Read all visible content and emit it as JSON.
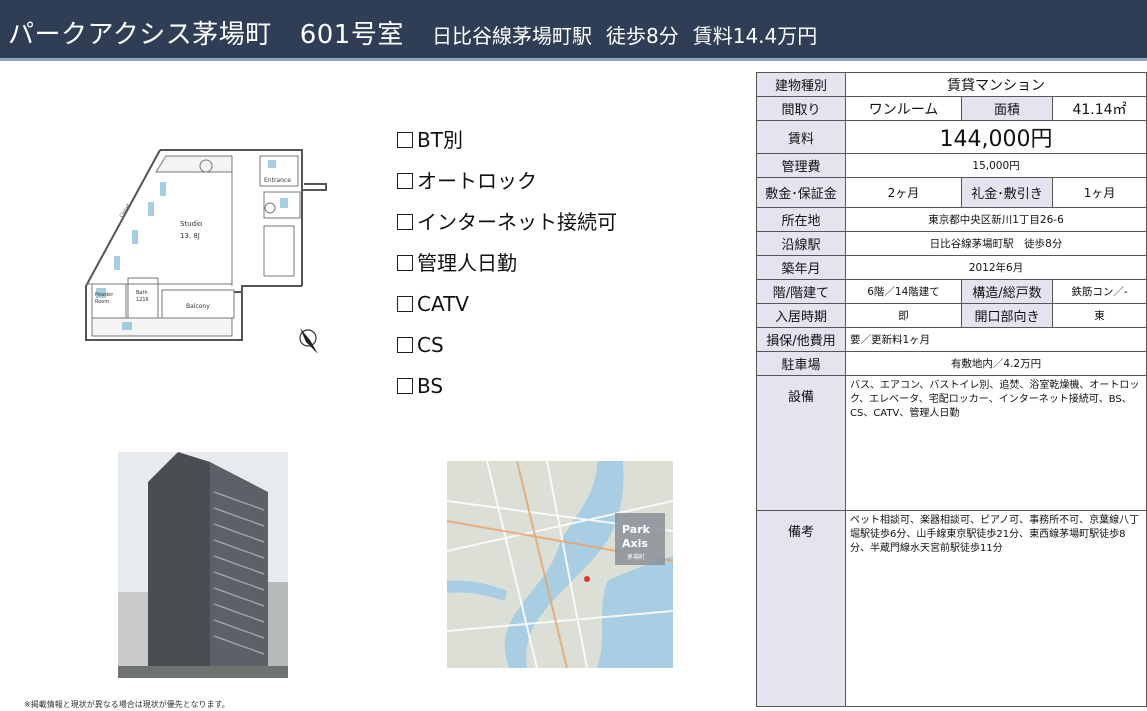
{
  "header": {
    "property_name": "パークアクシス茅場町",
    "room": "601号室",
    "station": "日比谷線茅場町駅",
    "walk": "徒歩8分",
    "rent": "賃料14.4万円"
  },
  "floorplan": {
    "entrance": "Entrance",
    "studio": "Studio",
    "studio_size": "13. 8J",
    "powder": "Powder\nRoom",
    "bath": "Bath\n1216",
    "balcony": "Balcony",
    "closet": "Closet"
  },
  "features": [
    {
      "label": "BT別"
    },
    {
      "label": "オートロック"
    },
    {
      "label": "インターネット接続可"
    },
    {
      "label": "管理人日勤"
    },
    {
      "label": "CATV"
    },
    {
      "label": "CS"
    },
    {
      "label": "BS"
    }
  ],
  "map": {
    "logo_line1": "Park",
    "logo_line2": "Axis",
    "logo_sub": "茅場町"
  },
  "table": {
    "building_type_label": "建物種別",
    "building_type": "賃貸マンション",
    "layout_label": "間取り",
    "layout": "ワンルーム",
    "area_label": "面積",
    "area": "41.14㎡",
    "rent_label": "賃料",
    "rent": "144,000円",
    "mgmt_label": "管理費",
    "mgmt": "15,000円",
    "deposit_label": "敷金･保証金",
    "deposit": "2ヶ月",
    "key_money_label": "礼金･敷引き",
    "key_money": "1ヶ月",
    "address_label": "所在地",
    "address": "東京都中央区新川1丁目26-6",
    "line_label": "沿線駅",
    "line": "日比谷線茅場町駅　徒歩8分",
    "built_label": "築年月",
    "built": "2012年6月",
    "floor_label": "階/階建て",
    "floor": "6階／14階建て",
    "structure_label": "構造/総戸数",
    "structure": "鉄筋コン／-",
    "movein_label": "入居時期",
    "movein": "即",
    "direction_label": "開口部向き",
    "direction": "東",
    "insurance_label": "損保/他費用",
    "insurance": "要／更新料1ヶ月",
    "parking_label": "駐車場",
    "parking": "有敷地内／4.2万円",
    "equipment_label": "設備",
    "equipment": "バス、エアコン、バストイレ別、追焚、浴室乾燥機、オートロック、エレベータ、宅配ロッカー、インターネット接続可、BS、CS、CATV、管理人日勤",
    "notes_label": "備考",
    "notes": "ペット相談可、楽器相談可、ピアノ可、事務所不可、京葉線八丁堀駅徒歩6分、山手線東京駅徒歩21分、東西線茅場町駅徒歩8分、半蔵門線水天宮前駅徒歩11分"
  },
  "footnote": "※掲載情報と現状が異なる場合は現状が優先となります。",
  "colors": {
    "header_bg": "#2f3e55",
    "label_bg": "#e6e2f0"
  }
}
